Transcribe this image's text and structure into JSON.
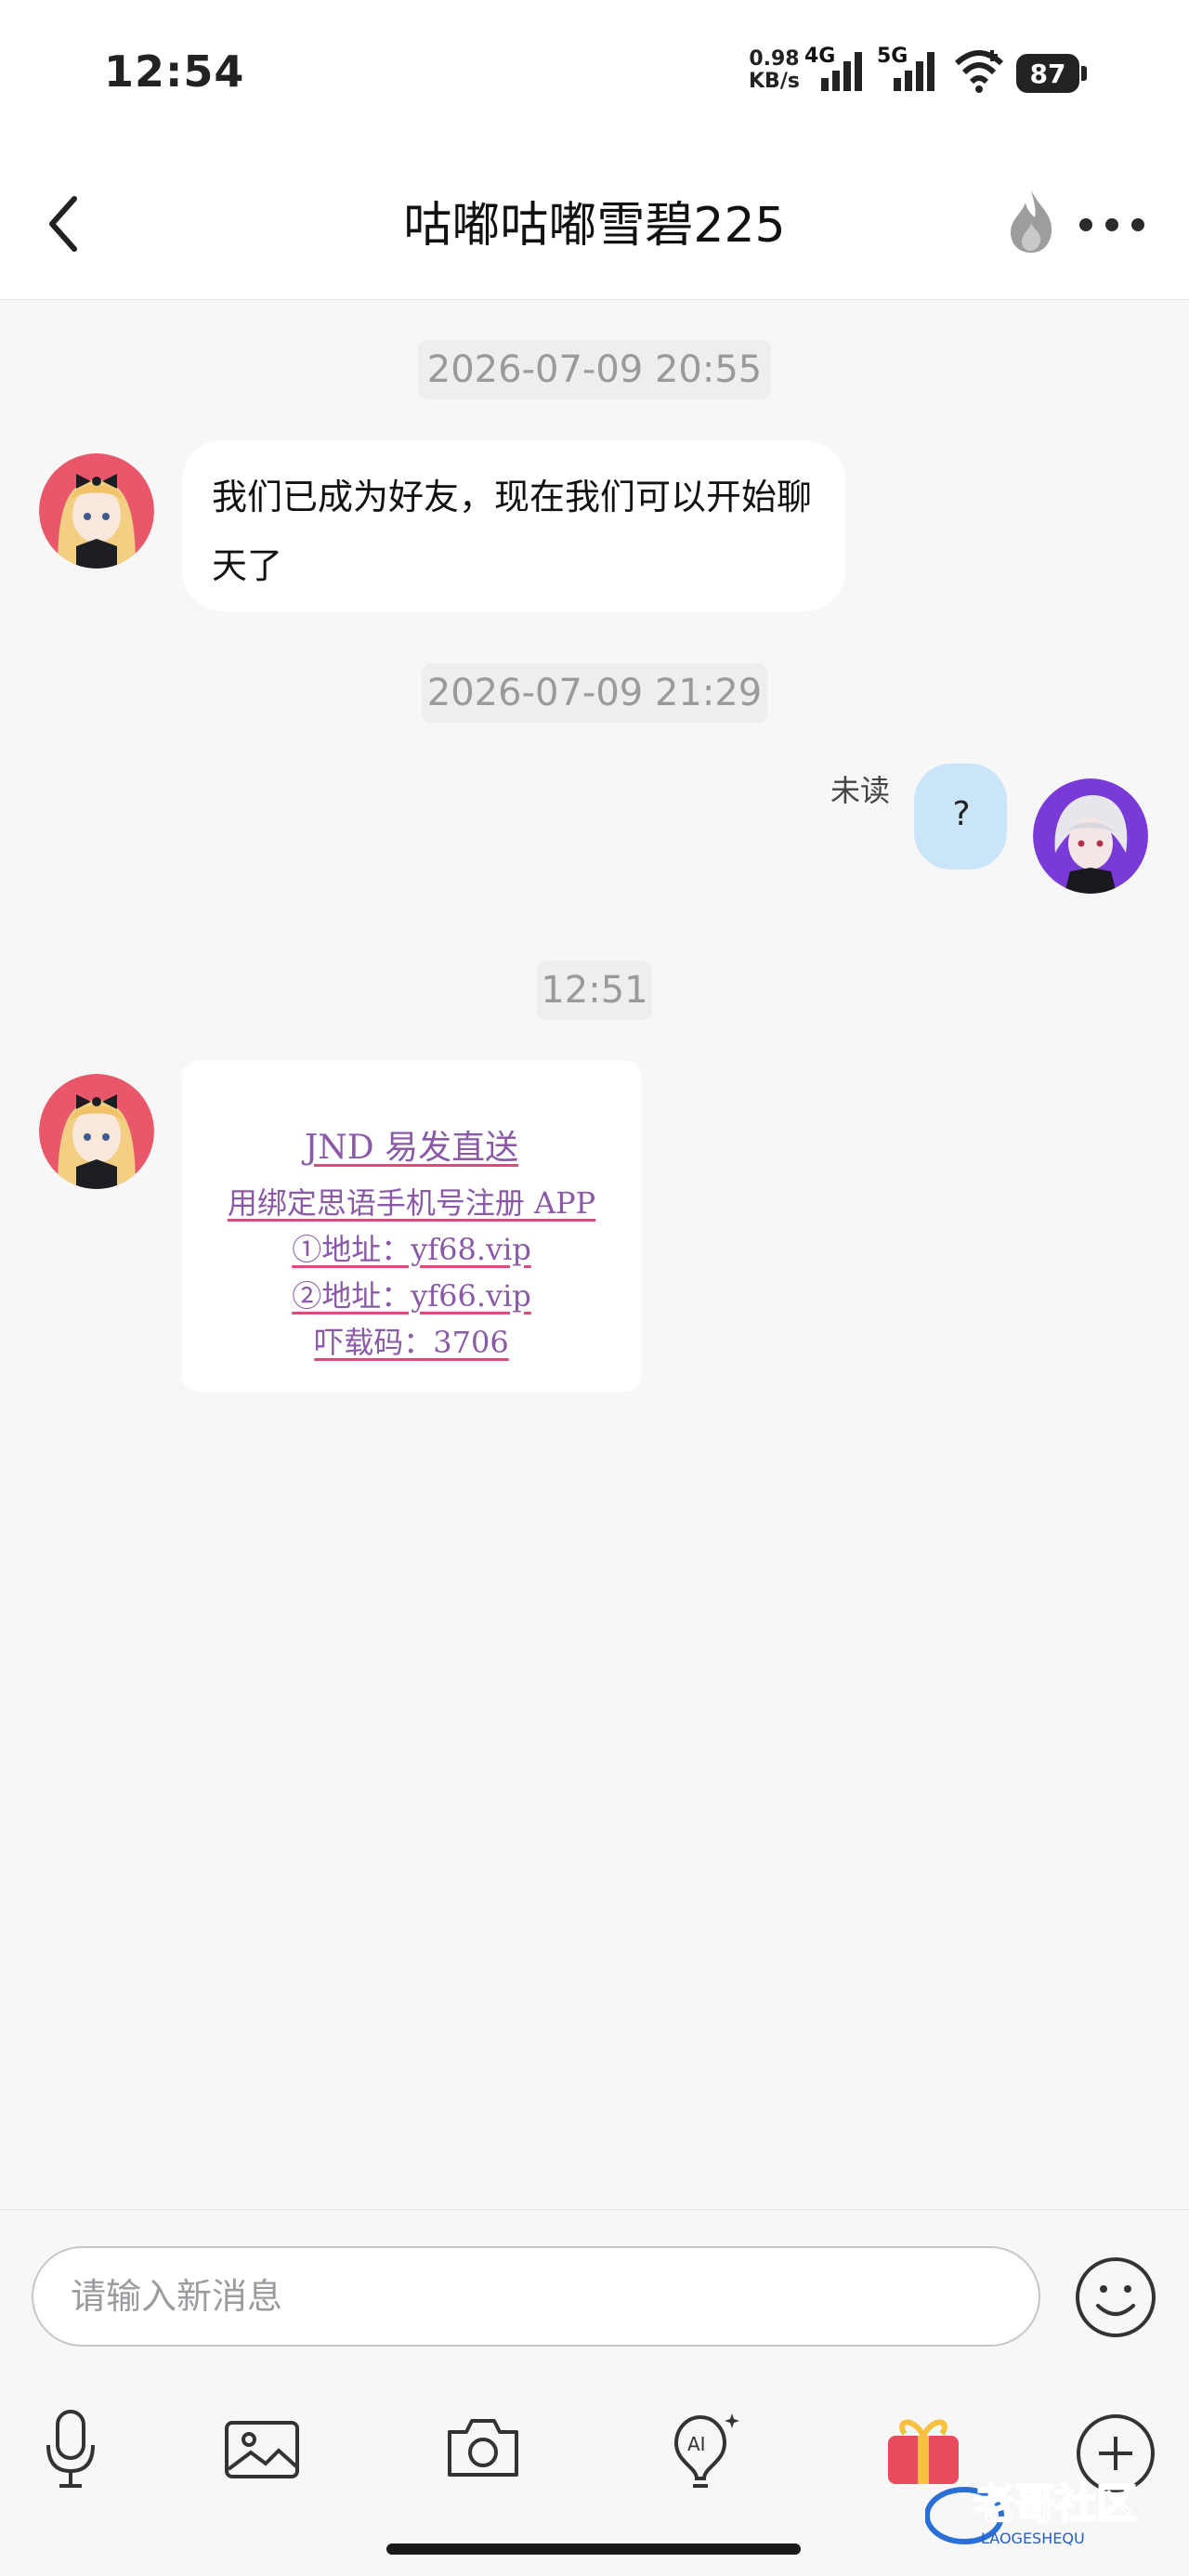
{
  "status_bar": {
    "time": "12:54",
    "speed_value": "0.98",
    "speed_unit": "KB/s",
    "net1": "4G",
    "net2": "5G",
    "battery": "87"
  },
  "header": {
    "title": "咕嘟咕嘟雪碧225"
  },
  "messages": [
    {
      "type": "timestamp",
      "text": "2026-07-09 20:55"
    },
    {
      "type": "incoming",
      "text": "我们已成为好友，现在我们可以开始聊天了"
    },
    {
      "type": "timestamp",
      "text": "2026-07-09 21:29"
    },
    {
      "type": "outgoing",
      "status": "未读",
      "text": "?"
    },
    {
      "type": "timestamp",
      "text": "12:51"
    },
    {
      "type": "incoming-card",
      "lines": [
        "JND 易发直送",
        "用绑定思语手机号注册 APP",
        "①地址：yf68.vip",
        "②地址：yf66.vip",
        "吓载码：3706"
      ]
    }
  ],
  "composer": {
    "placeholder": "请输入新消息"
  },
  "colors": {
    "outgoing_bubble": "#c9e5f7",
    "promo_text": "#8a5aa8",
    "promo_underline": "#d64f7a"
  },
  "watermark": {
    "text": "老哥社区",
    "sub": "LAOGESHEQU"
  }
}
